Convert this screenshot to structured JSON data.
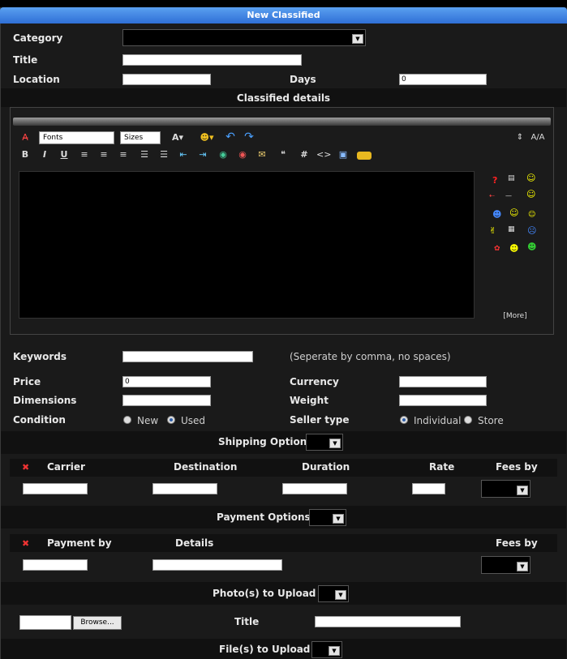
{
  "window": {
    "title": "New Classified"
  },
  "form": {
    "category_label": "Category",
    "title_label": "Title",
    "location_label": "Location",
    "days_label": "Days",
    "days_value": "0",
    "details_header": "Classified details",
    "keywords_label": "Keywords",
    "keywords_hint": "(Seperate by comma, no spaces)",
    "price_label": "Price",
    "price_value": "0",
    "currency_label": "Currency",
    "dimensions_label": "Dimensions",
    "weight_label": "Weight",
    "condition_label": "Condition",
    "condition_options": [
      "New",
      "Used"
    ],
    "condition_selected": "Used",
    "seller_type_label": "Seller type",
    "seller_type_options": [
      "Individual",
      "Store"
    ],
    "seller_type_selected": "Individual"
  },
  "editor": {
    "font_select": "Fonts",
    "size_select": "Sizes",
    "more_link": "[More]",
    "toolbar_icons": [
      "remove-format-icon",
      "font-color-icon",
      "smiley-picker-icon",
      "undo-icon",
      "redo-icon",
      "resize-icon",
      "swap-mode-icon",
      "bold-icon",
      "italic-icon",
      "underline-icon",
      "align-left-icon",
      "align-center-icon",
      "align-right-icon",
      "ordered-list-icon",
      "unordered-list-icon",
      "outdent-icon",
      "indent-icon",
      "insert-link-icon",
      "remove-link-icon",
      "email-icon",
      "quote-icon",
      "hash-icon",
      "code-icon",
      "image-icon",
      "media-icon"
    ]
  },
  "shipping": {
    "header": "Shipping Option",
    "columns": [
      "Carrier",
      "Destination",
      "Duration",
      "Rate",
      "Fees by"
    ]
  },
  "payment": {
    "header": "Payment Options",
    "columns": [
      "Payment by",
      "Details",
      "Fees by"
    ]
  },
  "photos": {
    "header": "Photo(s) to Upload",
    "browse_label": "Browse...",
    "title_label": "Title"
  },
  "files": {
    "header": "File(s) to Upload"
  }
}
